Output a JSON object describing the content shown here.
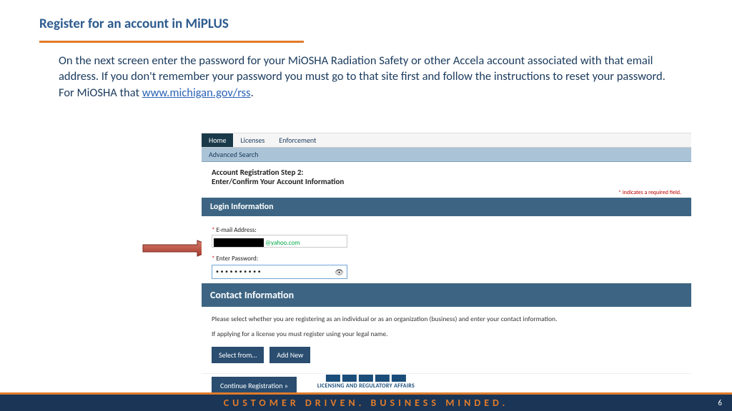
{
  "slide": {
    "title": "Register for an account in MiPLUS",
    "instruction_pre": "On the next screen enter the password for your MiOSHA Radiation Safety or other Accela account associated with that email address.  If you don't remember your password you must go to that site first and follow the instructions to reset your password.  For MiOSHA that ",
    "link_text": "www.michigan.gov/rss",
    "instruction_post": "."
  },
  "app": {
    "tabs": {
      "home": "Home",
      "licenses": "Licenses",
      "enforcement": "Enforcement"
    },
    "advanced_search": "Advanced Search",
    "step_line1": "Account Registration Step 2:",
    "step_line2": "Enter/Confirm Your Account Information",
    "required_note": "* indicates a required field.",
    "login_header": "Login Information",
    "email_label": "E-mail Address:",
    "email_domain": "@yahoo.com",
    "password_label": "Enter Password:",
    "password_value": "••••••••••",
    "contact_header": "Contact Information",
    "contact_text1": "Please select whether you are registering as an individual or as an organization (business) and enter your contact information.",
    "contact_text2": "If applying for a license you must register using your legal name.",
    "select_from": "Select from…",
    "add_new": "Add New",
    "continue": "Continue Registration »"
  },
  "logo": {
    "sub": "LICENSING AND REGULATORY AFFAIRS"
  },
  "footer": {
    "tagline": "CUSTOMER DRIVEN.  BUSINESS MINDED.",
    "page": "6"
  }
}
